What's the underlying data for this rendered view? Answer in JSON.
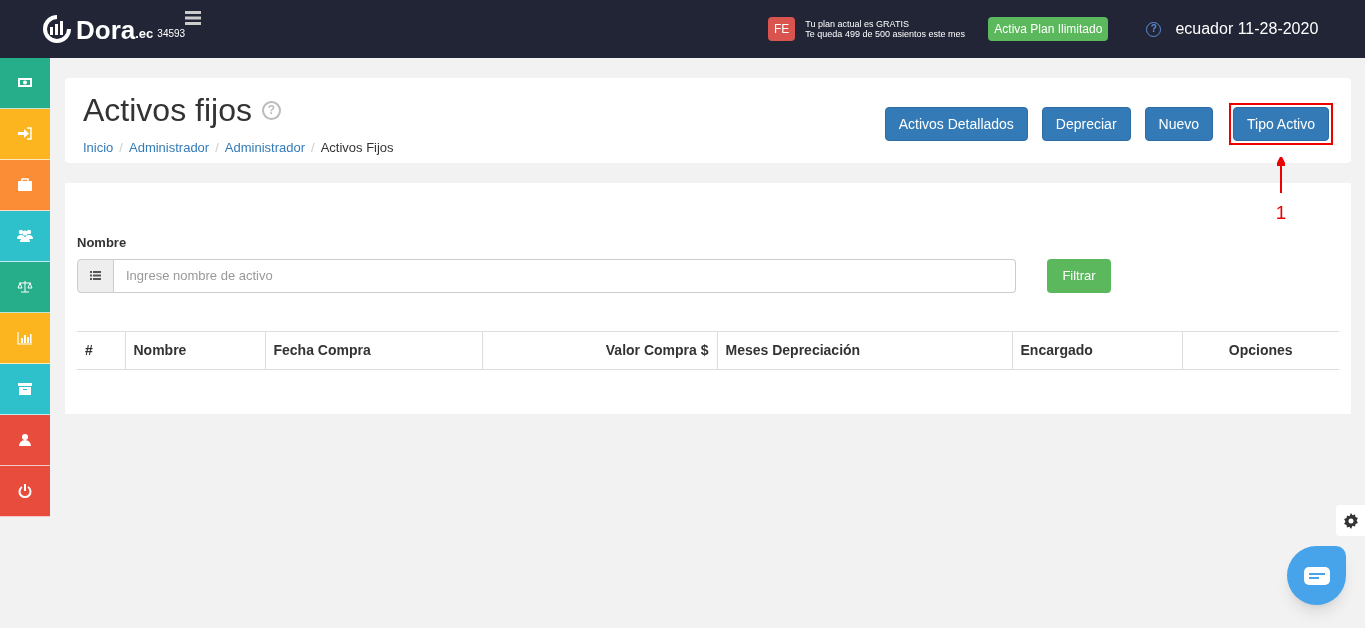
{
  "header": {
    "logo": "Dora",
    "logo_suffix": ".ec",
    "account": "34593",
    "plan_badge": "FE",
    "plan_lines": [
      "Tu plan actual es GRATIS",
      "Te queda 499 de 500 asientos este mes"
    ],
    "upgrade_button": "Activa Plan Ilimitado",
    "user": "ecuador 11-28-2020",
    "help_glyph": "?"
  },
  "sidebar": {
    "items": [
      {
        "kind": "money",
        "color": "#26ad89"
      },
      {
        "kind": "login",
        "color": "#fcb41f"
      },
      {
        "kind": "briefcase",
        "color": "#fb8d36"
      },
      {
        "kind": "users",
        "color": "#2ec0cb"
      },
      {
        "kind": "scale",
        "color": "#26ad89"
      },
      {
        "kind": "chart",
        "color": "#fcb41f"
      },
      {
        "kind": "archive",
        "color": "#2ec0cb"
      },
      {
        "kind": "user",
        "color": "#e84c3d"
      },
      {
        "kind": "power",
        "color": "#e84c3d"
      }
    ]
  },
  "page": {
    "title": "Activos fijos",
    "help_glyph": "?",
    "breadcrumb_separator": "/",
    "breadcrumb": [
      {
        "label": "Inicio",
        "link": true
      },
      {
        "label": "Administrador",
        "link": true
      },
      {
        "label": "Administrador",
        "link": true
      },
      {
        "label": "Activos Fijos",
        "link": false
      }
    ],
    "buttons": [
      {
        "label": "Activos Detallados",
        "highlighted": false
      },
      {
        "label": "Depreciar",
        "highlighted": false
      },
      {
        "label": "Nuevo",
        "highlighted": false
      },
      {
        "label": "Tipo Activo",
        "highlighted": true
      }
    ],
    "annotation": "1"
  },
  "filter": {
    "label": "Nombre",
    "placeholder": "Ingrese nombre de activo",
    "button": "Filtrar"
  },
  "table": {
    "columns": [
      "#",
      "Nombre",
      "Fecha Compra",
      "Valor Compra $",
      "Meses Depreciación",
      "Encargado",
      "Opciones"
    ]
  }
}
